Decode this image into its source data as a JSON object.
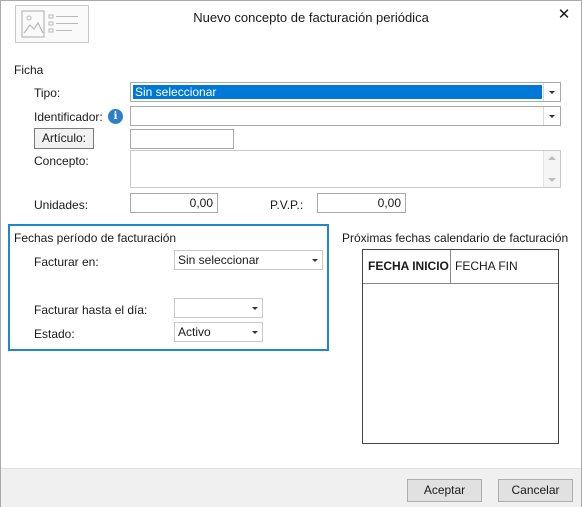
{
  "window": {
    "title": "Nuevo concepto de facturación periódica",
    "close_label": "✕"
  },
  "ficha": {
    "section_label": "Ficha",
    "tipo": {
      "label": "Tipo:",
      "value": "Sin seleccionar"
    },
    "identificador": {
      "label": "Identificador:",
      "value": ""
    },
    "articulo": {
      "button_label": "Artículo:",
      "value": ""
    },
    "concepto": {
      "label": "Concepto:",
      "value": ""
    },
    "unidades": {
      "label": "Unidades:",
      "value": "0,00"
    },
    "pvp": {
      "label": "P.V.P.:",
      "value": "0,00"
    }
  },
  "fechas": {
    "group_label": "Fechas período de facturación",
    "facturar_en": {
      "label": "Facturar en:",
      "value": "Sin seleccionar"
    },
    "facturar_hasta": {
      "label": "Facturar hasta el día:",
      "value": ""
    },
    "estado": {
      "label": "Estado:",
      "value": "Activo"
    }
  },
  "proximas": {
    "label": "Próximas fechas calendario de facturación",
    "columns": [
      "FECHA INICIO",
      "FECHA FIN"
    ],
    "rows": []
  },
  "footer": {
    "accept_label": "Aceptar",
    "cancel_label": "Cancelar"
  },
  "colors": {
    "accent": "#1f86d1",
    "selection": "#0078d7",
    "info": "#2f7fc8"
  },
  "icons": [
    "image-placeholder-icon",
    "close-icon",
    "info-icon",
    "chevron-down-icon"
  ]
}
